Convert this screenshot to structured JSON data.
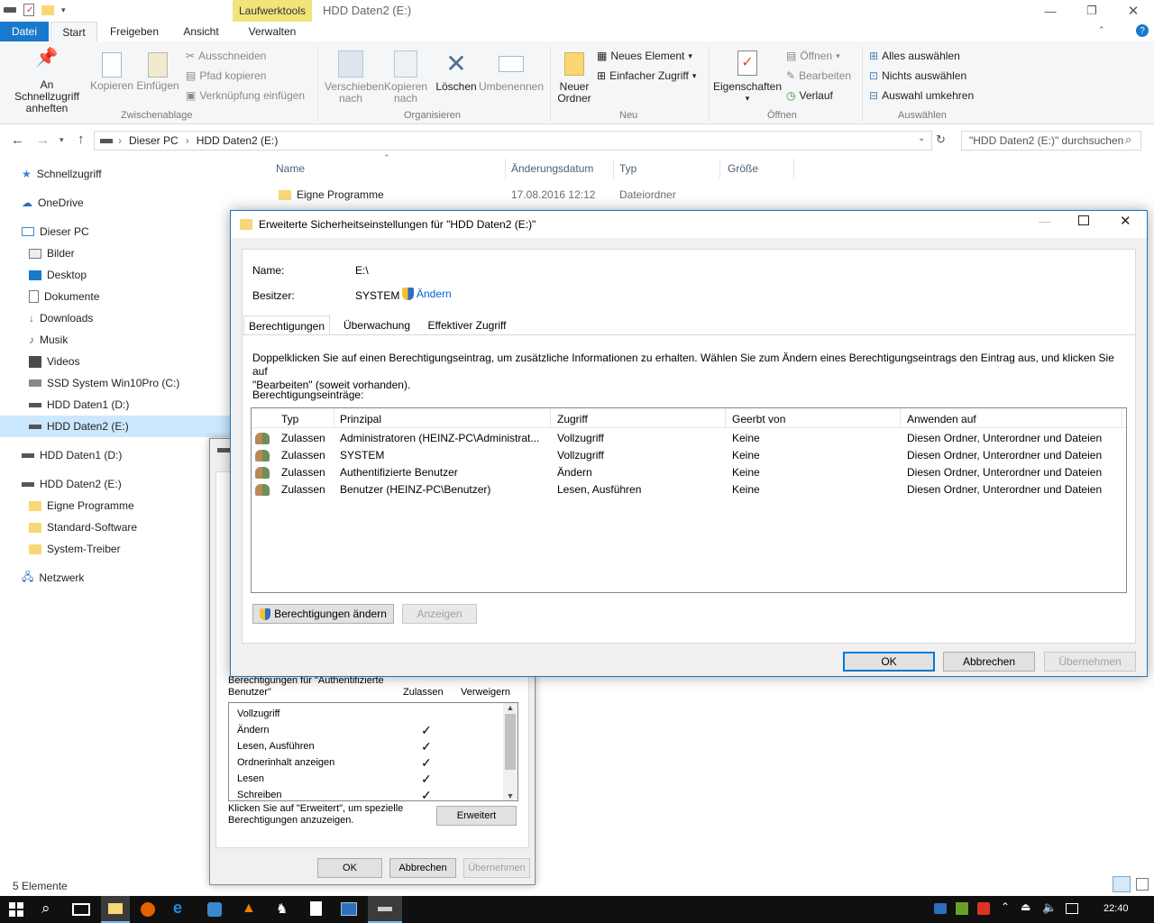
{
  "window": {
    "title": "HDD Daten2 (E:)",
    "context_tab": "Laufwerktools"
  },
  "ribbon": {
    "tabs": [
      "Datei",
      "Start",
      "Freigeben",
      "Ansicht",
      "Verwalten"
    ],
    "clipboard": {
      "pin": "An Schnellzugriff anheften",
      "copy": "Kopieren",
      "paste": "Einfügen",
      "cut": "Ausschneiden",
      "copy_path": "Pfad kopieren",
      "paste_shortcut": "Verknüpfung einfügen",
      "group": "Zwischenablage"
    },
    "organize": {
      "move": "Verschieben nach",
      "copy_to": "Kopieren nach",
      "delete": "Löschen",
      "rename": "Umbenennen",
      "group": "Organisieren"
    },
    "new": {
      "folder": "Neuer Ordner",
      "item": "Neues Element",
      "easy_access": "Einfacher Zugriff",
      "group": "Neu"
    },
    "open": {
      "properties": "Eigenschaften",
      "open": "Öffnen",
      "edit": "Bearbeiten",
      "history": "Verlauf",
      "group": "Öffnen"
    },
    "select": {
      "all": "Alles auswählen",
      "none": "Nichts auswählen",
      "invert": "Auswahl umkehren",
      "group": "Auswählen"
    }
  },
  "address": {
    "crumbs": [
      "Dieser PC",
      "HDD Daten2 (E:)"
    ],
    "search_placeholder": "\"HDD Daten2 (E:)\" durchsuchen"
  },
  "nav": {
    "items": [
      "Schnellzugriff",
      "OneDrive",
      "Dieser PC",
      "Bilder",
      "Desktop",
      "Dokumente",
      "Downloads",
      "Musik",
      "Videos",
      "SSD System Win10Pro (C:)",
      "HDD Daten1 (D:)",
      "HDD Daten2 (E:)",
      "HDD Daten1 (D:)",
      "HDD Daten2 (E:)",
      "Eigne Programme",
      "Standard-Software",
      "System-Treiber",
      "Netzwerk"
    ]
  },
  "files": {
    "columns": [
      "Name",
      "Änderungsdatum",
      "Typ",
      "Größe"
    ],
    "rows": [
      {
        "name": "Eigne Programme",
        "date": "17.08.2016 12:12",
        "type": "Dateiordner"
      }
    ]
  },
  "status": {
    "count": "5 Elemente"
  },
  "dialog_props": {
    "perm_for_1": "Berechtigungen für \"Authentifizierte",
    "perm_for_2": "Benutzer\"",
    "allow": "Zulassen",
    "deny": "Verweigern",
    "perms": [
      "Vollzugriff",
      "Ändern",
      "Lesen, Ausführen",
      "Ordnerinhalt anzeigen",
      "Lesen",
      "Schreiben"
    ],
    "checked": [
      false,
      true,
      true,
      true,
      true,
      true
    ],
    "hint_1": "Klicken Sie auf \"Erweitert\", um spezielle",
    "hint_2": "Berechtigungen anzuzeigen.",
    "advanced": "Erweitert",
    "ok": "OK",
    "cancel": "Abbrechen",
    "apply": "Übernehmen"
  },
  "dialog_adv": {
    "title": "Erweiterte Sicherheitseinstellungen für \"HDD Daten2 (E:)\"",
    "name_label": "Name:",
    "name_value": "E:\\",
    "owner_label": "Besitzer:",
    "owner_value": "SYSTEM",
    "change": "Ändern",
    "tabs": [
      "Berechtigungen",
      "Überwachung",
      "Effektiver Zugriff"
    ],
    "info_1": "Doppelklicken Sie auf einen Berechtigungseintrag, um zusätzliche Informationen zu erhalten. Wählen Sie zum Ändern eines Berechtigungseintrags den Eintrag aus, und klicken Sie auf",
    "info_2": "\"Bearbeiten\" (soweit vorhanden).",
    "entries_label": "Berechtigungseinträge:",
    "columns": [
      "Typ",
      "Prinzipal",
      "Zugriff",
      "Geerbt von",
      "Anwenden auf"
    ],
    "entries": [
      {
        "type": "Zulassen",
        "principal": "Administratoren (HEINZ-PC\\Administrat...",
        "access": "Vollzugriff",
        "inherited": "Keine",
        "applies": "Diesen Ordner, Unterordner und Dateien"
      },
      {
        "type": "Zulassen",
        "principal": "SYSTEM",
        "access": "Vollzugriff",
        "inherited": "Keine",
        "applies": "Diesen Ordner, Unterordner und Dateien"
      },
      {
        "type": "Zulassen",
        "principal": "Authentifizierte Benutzer",
        "access": "Ändern",
        "inherited": "Keine",
        "applies": "Diesen Ordner, Unterordner und Dateien"
      },
      {
        "type": "Zulassen",
        "principal": "Benutzer (HEINZ-PC\\Benutzer)",
        "access": "Lesen, Ausführen",
        "inherited": "Keine",
        "applies": "Diesen Ordner, Unterordner und Dateien"
      }
    ],
    "change_perms": "Berechtigungen ändern",
    "show": "Anzeigen",
    "ok": "OK",
    "cancel": "Abbrechen",
    "apply": "Übernehmen"
  },
  "taskbar": {
    "time": "22:40"
  }
}
